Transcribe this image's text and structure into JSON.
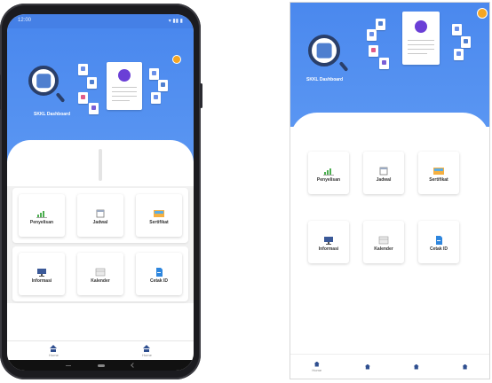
{
  "colors": {
    "header_blue": "#4a88ee",
    "accent_orange": "#f5a623",
    "phone_frame": "#1b1b1f",
    "nav_icon": "#2f4f8f"
  },
  "app": {
    "brand_name": "SKKL Dashboard",
    "time": "12:00",
    "status_icons": "▾ ▮▮ ▮"
  },
  "menu": [
    {
      "label": "Penyelisan",
      "icon": "chart-icon"
    },
    {
      "label": "Jadwal",
      "icon": "calendar-icon"
    },
    {
      "label": "Sertifikat",
      "icon": "certificate-icon"
    },
    {
      "label": "Informasi",
      "icon": "monitor-icon"
    },
    {
      "label": "Kalender",
      "icon": "calendar-grid-icon"
    },
    {
      "label": "Cetak ID",
      "icon": "id-card-icon"
    }
  ],
  "phone_nav": [
    {
      "label": "Home",
      "icon": "home-icon"
    },
    {
      "label": "Home",
      "icon": "home-icon"
    }
  ],
  "tablet_nav": [
    {
      "label": "Home",
      "icon": "home-icon"
    },
    {
      "label": "",
      "icon": "home-icon"
    },
    {
      "label": "",
      "icon": "home-icon"
    },
    {
      "label": "",
      "icon": "home-icon"
    }
  ]
}
